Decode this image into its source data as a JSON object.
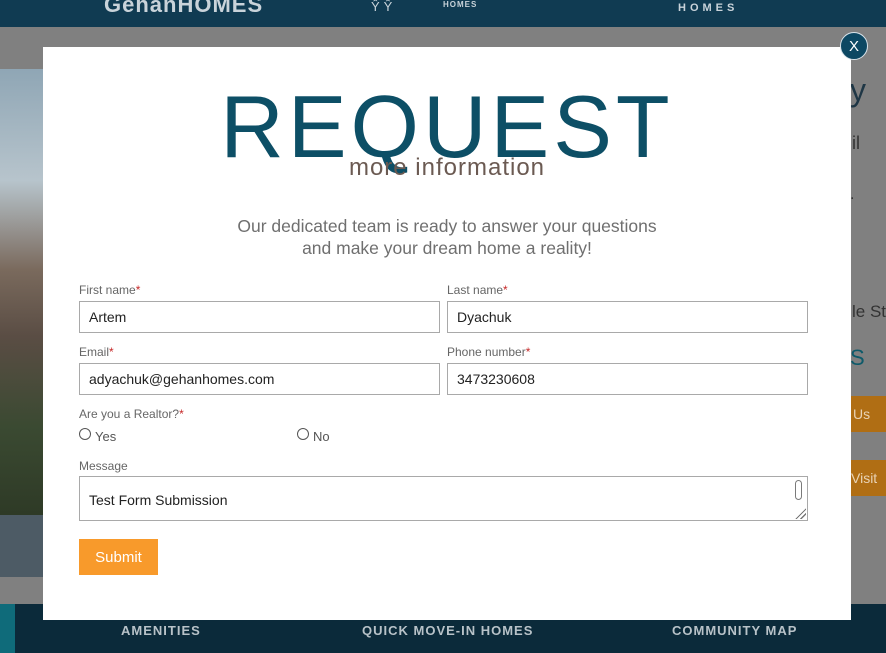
{
  "background": {
    "header": {
      "logo_left": "GehanHOMES",
      "logo_center_icon": "ŶŶ",
      "logo_center_text": "HOMES",
      "logo_right": "HOMES"
    },
    "right_text": {
      "line1": "y",
      "line2": "il",
      "line3": ".",
      "line4": "le St",
      "line5": "S"
    },
    "buttons": [
      "Us",
      "Visit"
    ],
    "footer_links": [
      "AMENITIES",
      "QUICK MOVE-IN HOMES",
      "COMMUNITY MAP"
    ]
  },
  "modal": {
    "close_label": "X",
    "title": "REQUEST",
    "subtitle": "more information",
    "description_line1": "Our dedicated team is ready to answer your questions",
    "description_line2": "and make your dream home a reality!",
    "required_mark": "*",
    "fields": {
      "first_name": {
        "label": "First name",
        "value": "Artem"
      },
      "last_name": {
        "label": "Last name",
        "value": "Dyachuk"
      },
      "email": {
        "label": "Email",
        "value": "adyachuk@gehanhomes.com"
      },
      "phone": {
        "label": "Phone number",
        "value": "3473230608"
      },
      "realtor": {
        "label": "Are you a Realtor?",
        "options": [
          "Yes",
          "No"
        ],
        "selected": null
      },
      "message": {
        "label": "Message",
        "value": "Test Form Submission"
      }
    },
    "submit_label": "Submit"
  }
}
